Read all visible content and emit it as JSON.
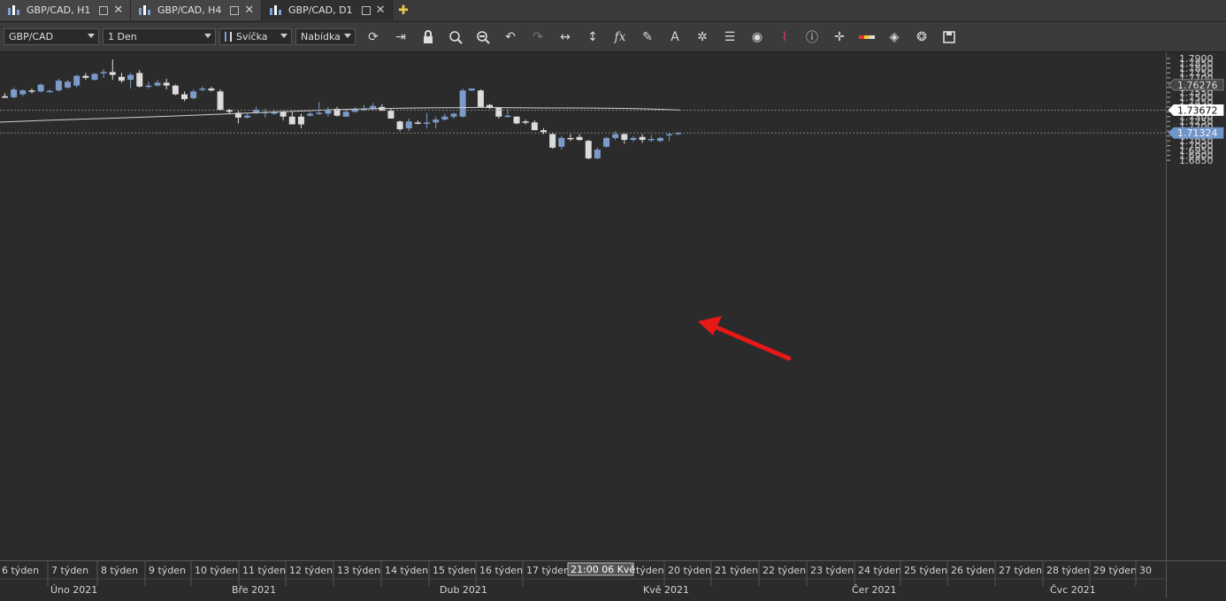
{
  "tabs": [
    {
      "label": "GBP/CAD, H1",
      "active": false
    },
    {
      "label": "GBP/CAD, H4",
      "active": false
    },
    {
      "label": "GBP/CAD, D1",
      "active": true
    }
  ],
  "toolbar": {
    "symbol": "GBP/CAD",
    "timeframe": "1 Den",
    "chart_type": "Svíčka",
    "price_side": "Nabídka",
    "icons": [
      "refresh-icon",
      "autoscroll-icon",
      "lock-icon",
      "zoom-in-icon",
      "zoom-out-icon",
      "undo-icon",
      "redo-icon",
      "horizontal-scale-icon",
      "vertical-scale-icon",
      "indicators-icon",
      "draw-icon",
      "text-icon",
      "objects-icon",
      "layers-icon",
      "visibility-icon",
      "alerts-icon",
      "info-icon",
      "crosshair-icon",
      "color-icon",
      "fill-icon",
      "settings-icon",
      "save-icon"
    ]
  },
  "colors": {
    "bull": "#7b9ccb",
    "bear": "#dcdcdc",
    "ma": "#cfcfcf",
    "arrow": "#e81818",
    "accent_label": "#6f95c9"
  },
  "chart_data": {
    "type": "candlestick",
    "symbol": "GBP/CAD",
    "ylim": [
      1.683,
      1.791
    ],
    "yticks": [
      "1.7900",
      "1.7850",
      "1.7800",
      "1.7750",
      "1.7700",
      "1.7650",
      "1.7600",
      "1.7550",
      "1.7500",
      "1.7450",
      "1.7400",
      "1.7350",
      "1.7300",
      "1.7250",
      "1.7200",
      "1.7150",
      "1.7100",
      "1.7050",
      "1.7000",
      "1.6950",
      "1.6900",
      "1.6850"
    ],
    "price_labels": [
      {
        "text": "1.76276",
        "value": 1.7628,
        "style": "grey"
      },
      {
        "text": "1.73672",
        "value": 1.7367,
        "style": "white"
      },
      {
        "text": "1.71324",
        "value": 1.7132,
        "style": "blue"
      }
    ],
    "candles": [
      [
        1.751,
        1.754,
        1.749,
        1.7495
      ],
      [
        1.75,
        1.76,
        1.749,
        1.758
      ],
      [
        1.753,
        1.758,
        1.751,
        1.757
      ],
      [
        1.757,
        1.759,
        1.754,
        1.756
      ],
      [
        1.756,
        1.764,
        1.755,
        1.763
      ],
      [
        1.756,
        1.758,
        1.755,
        1.7565
      ],
      [
        1.757,
        1.769,
        1.756,
        1.767
      ],
      [
        1.76,
        1.768,
        1.759,
        1.766
      ],
      [
        1.762,
        1.773,
        1.76,
        1.772
      ],
      [
        1.772,
        1.775,
        1.768,
        1.77
      ],
      [
        1.768,
        1.775,
        1.767,
        1.774
      ],
      [
        1.775,
        1.779,
        1.77,
        1.776
      ],
      [
        1.776,
        1.789,
        1.768,
        1.773
      ],
      [
        1.771,
        1.775,
        1.765,
        1.767
      ],
      [
        1.768,
        1.775,
        1.759,
        1.773
      ],
      [
        1.775,
        1.778,
        1.76,
        1.761
      ],
      [
        1.761,
        1.766,
        1.759,
        1.762
      ],
      [
        1.762,
        1.768,
        1.761,
        1.765
      ],
      [
        1.765,
        1.769,
        1.758,
        1.762
      ],
      [
        1.762,
        1.763,
        1.752,
        1.753
      ],
      [
        1.753,
        1.756,
        1.746,
        1.748
      ],
      [
        1.749,
        1.758,
        1.748,
        1.756
      ],
      [
        1.758,
        1.761,
        1.756,
        1.759
      ],
      [
        1.759,
        1.761,
        1.756,
        1.757
      ],
      [
        1.756,
        1.758,
        1.736,
        1.737
      ],
      [
        1.737,
        1.738,
        1.733,
        1.735
      ],
      [
        1.734,
        1.736,
        1.723,
        1.729
      ],
      [
        1.729,
        1.733,
        1.728,
        1.731
      ],
      [
        1.734,
        1.74,
        1.733,
        1.737
      ],
      [
        1.734,
        1.738,
        1.729,
        1.735
      ],
      [
        1.733,
        1.737,
        1.732,
        1.735
      ],
      [
        1.735,
        1.736,
        1.726,
        1.73
      ],
      [
        1.73,
        1.735,
        1.725,
        1.722
      ],
      [
        1.73,
        1.733,
        1.718,
        1.722
      ],
      [
        1.731,
        1.735,
        1.73,
        1.733
      ],
      [
        1.733,
        1.745,
        1.732,
        1.734
      ],
      [
        1.733,
        1.74,
        1.73,
        1.737
      ],
      [
        1.738,
        1.74,
        1.73,
        1.731
      ],
      [
        1.73,
        1.737,
        1.73,
        1.735
      ],
      [
        1.735,
        1.74,
        1.734,
        1.738
      ],
      [
        1.737,
        1.742,
        1.736,
        1.738
      ],
      [
        1.738,
        1.744,
        1.736,
        1.741
      ],
      [
        1.74,
        1.743,
        1.738,
        1.736
      ],
      [
        1.736,
        1.738,
        1.728,
        1.728
      ],
      [
        1.725,
        1.726,
        1.715,
        1.717
      ],
      [
        1.718,
        1.728,
        1.715,
        1.725
      ],
      [
        1.724,
        1.726,
        1.722,
        1.723
      ],
      [
        1.723,
        1.734,
        1.718,
        1.724
      ],
      [
        1.724,
        1.73,
        1.718,
        1.727
      ],
      [
        1.727,
        1.733,
        1.726,
        1.73
      ],
      [
        1.73,
        1.734,
        1.728,
        1.733
      ],
      [
        1.73,
        1.759,
        1.729,
        1.757
      ],
      [
        1.757,
        1.759,
        1.756,
        1.759
      ],
      [
        1.757,
        1.758,
        1.74,
        1.74
      ],
      [
        1.742,
        1.743,
        1.738,
        1.739
      ],
      [
        1.739,
        1.74,
        1.728,
        1.73
      ],
      [
        1.73,
        1.738,
        1.729,
        1.731
      ],
      [
        1.73,
        1.73,
        1.722,
        1.723
      ],
      [
        1.725,
        1.727,
        1.722,
        1.724
      ],
      [
        1.724,
        1.726,
        1.716,
        1.716
      ],
      [
        1.716,
        1.718,
        1.712,
        1.714
      ],
      [
        1.712,
        1.713,
        1.697,
        1.698
      ],
      [
        1.699,
        1.71,
        1.696,
        1.708
      ],
      [
        1.708,
        1.712,
        1.705,
        1.707
      ],
      [
        1.709,
        1.712,
        1.705,
        1.706
      ],
      [
        1.705,
        1.706,
        1.686,
        1.687
      ],
      [
        1.687,
        1.698,
        1.686,
        1.696
      ],
      [
        1.699,
        1.709,
        1.698,
        1.708
      ],
      [
        1.708,
        1.715,
        1.706,
        1.712
      ],
      [
        1.712,
        1.713,
        1.702,
        1.706
      ],
      [
        1.706,
        1.71,
        1.704,
        1.708
      ],
      [
        1.709,
        1.712,
        1.703,
        1.706
      ],
      [
        1.706,
        1.711,
        1.704,
        1.707
      ],
      [
        1.705,
        1.709,
        1.704,
        1.708
      ],
      [
        1.711,
        1.713,
        1.705,
        1.712
      ],
      [
        1.712,
        1.714,
        1.711,
        1.7133
      ]
    ],
    "ma_line": [
      1.7243,
      1.7252,
      1.7261,
      1.7268,
      1.7276,
      1.7283,
      1.7291,
      1.7299,
      1.7307,
      1.7316,
      1.7325,
      1.7334,
      1.7343,
      1.7352,
      1.7361,
      1.737,
      1.7376,
      1.7381,
      1.7385,
      1.7389,
      1.7391,
      1.7393,
      1.7396,
      1.7393,
      1.739,
      1.7389,
      1.7389,
      1.7388,
      1.7385,
      1.7383,
      1.7375,
      1.7367
    ],
    "x_week_labels": [
      "6 týden",
      "7 týden",
      "8 týden",
      "9 týden",
      "10 týden",
      "11 týden",
      "12 týden",
      "13 týden",
      "14 týden",
      "15 týden",
      "16 týden",
      "17 týden",
      "20 týden",
      "21 týden",
      "22 týden",
      "23 týden",
      "24 týden",
      "25 týden",
      "26 týden",
      "27 týden",
      "28 týden",
      "29 týden",
      "30"
    ],
    "x_crosshair_label": "21:00 06 Kvě",
    "x_crosshair_suffix": "týden",
    "x_month_labels": [
      "Úno 2021",
      "Bře 2021",
      "Dub 2021",
      "Kvě 2021",
      "Čer 2021",
      "Čvc 2021"
    ]
  }
}
